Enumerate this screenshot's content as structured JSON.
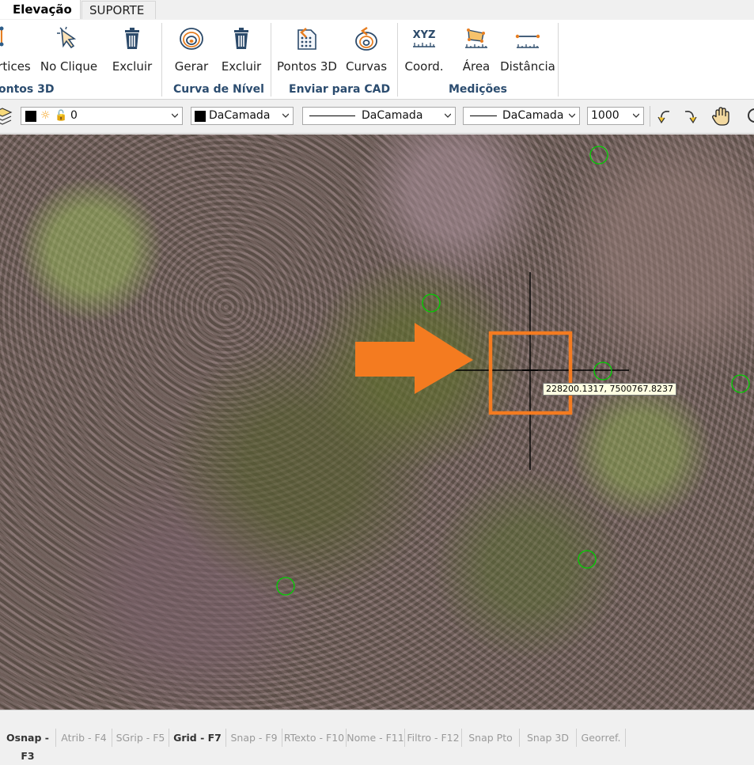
{
  "tabs": {
    "active": "Elevação",
    "inactive": "SUPORTE"
  },
  "ribbon": {
    "buttons": [
      {
        "label": "rtices",
        "icon": "vertices-icon"
      },
      {
        "label": "No Clique",
        "icon": "click-cursor-icon"
      },
      {
        "label": "Excluir",
        "icon": "trash-icon"
      },
      {
        "label": "Gerar",
        "icon": "contour-generate-icon"
      },
      {
        "label": "Excluir",
        "icon": "trash-icon"
      },
      {
        "label": "Pontos 3D",
        "icon": "points-3d-icon"
      },
      {
        "label": "Curvas",
        "icon": "curves-icon"
      },
      {
        "label": "Coord.",
        "icon": "xyz-coord-icon"
      },
      {
        "label": "Área",
        "icon": "area-measure-icon"
      },
      {
        "label": "Distância",
        "icon": "distance-measure-icon"
      }
    ],
    "groups": [
      "ontos 3D",
      "Curva de Nível",
      "Enviar para CAD",
      "Medições"
    ],
    "xyz_text": "XYZ"
  },
  "toolbar": {
    "layer_value": "0",
    "color_value": "DaCamada",
    "linetype_value": "DaCamada",
    "lineweight_value": "DaCamada",
    "scale_value": "1000"
  },
  "viewport": {
    "coordinate_tooltip": "228200.1317, 7500767.8237",
    "accent_color": "#f47b20",
    "marker_color": "#00d000"
  },
  "statusbar": {
    "items": [
      {
        "label": "Osnap - F3",
        "on": true
      },
      {
        "label": "Atrib - F4",
        "on": false
      },
      {
        "label": "SGrip - F5",
        "on": false
      },
      {
        "label": "Grid - F7",
        "on": true
      },
      {
        "label": "Snap - F9",
        "on": false
      },
      {
        "label": "RTexto - F10",
        "on": false
      },
      {
        "label": "Nome - F11",
        "on": false
      },
      {
        "label": "Filtro - F12",
        "on": false
      },
      {
        "label": "Snap Pto",
        "on": false
      },
      {
        "label": "Snap 3D",
        "on": false
      },
      {
        "label": "Georref.",
        "on": false
      }
    ]
  }
}
